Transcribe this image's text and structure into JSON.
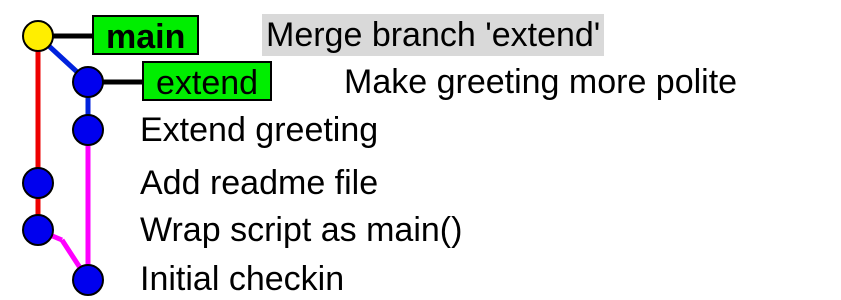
{
  "commits": [
    {
      "message": "Merge branch 'extend'",
      "refs": [
        "main"
      ],
      "head": true,
      "selected": true
    },
    {
      "message": "Make greeting more polite",
      "refs": [
        "extend"
      ]
    },
    {
      "message": "Extend greeting",
      "refs": []
    },
    {
      "message": "Add readme file",
      "refs": []
    },
    {
      "message": "Wrap script as main()",
      "refs": []
    },
    {
      "message": "Initial checkin",
      "refs": []
    }
  ],
  "colors": {
    "head_node": "#ffee00",
    "node": "#0000ee",
    "lane_main": "#ee0000",
    "lane_extend": "#0022dd",
    "lane_extend_lower": "#ff00ff",
    "ref_background": "#00ee00",
    "selected_background": "#d9d9d9"
  }
}
